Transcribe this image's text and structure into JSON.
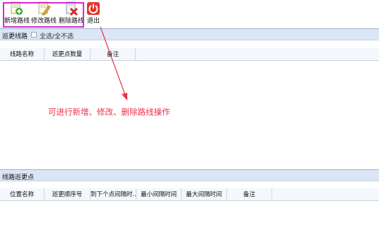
{
  "toolbar": {
    "add_route_label": "新增路线",
    "edit_route_label": "修改路线",
    "delete_route_label": "删除路线",
    "exit_label": "退出"
  },
  "routes_panel": {
    "title": "巡更线路",
    "select_all_label": "全选/全不选",
    "columns": [
      "线路名称",
      "巡更点数量",
      "备注"
    ]
  },
  "annotation": {
    "text": "可进行新增、修改、删除路线操作",
    "color": "#e8334a"
  },
  "points_panel": {
    "title": "线路巡更点",
    "columns": [
      "位置名称",
      "巡更顺序号",
      "到下个点间隔时...",
      "最小间隔时间",
      "最大间隔时间",
      "备注"
    ]
  },
  "colors": {
    "highlight": "#d62ad0",
    "panel_title_bg": "#dbe6f4",
    "exit_icon": "#e8332b"
  }
}
